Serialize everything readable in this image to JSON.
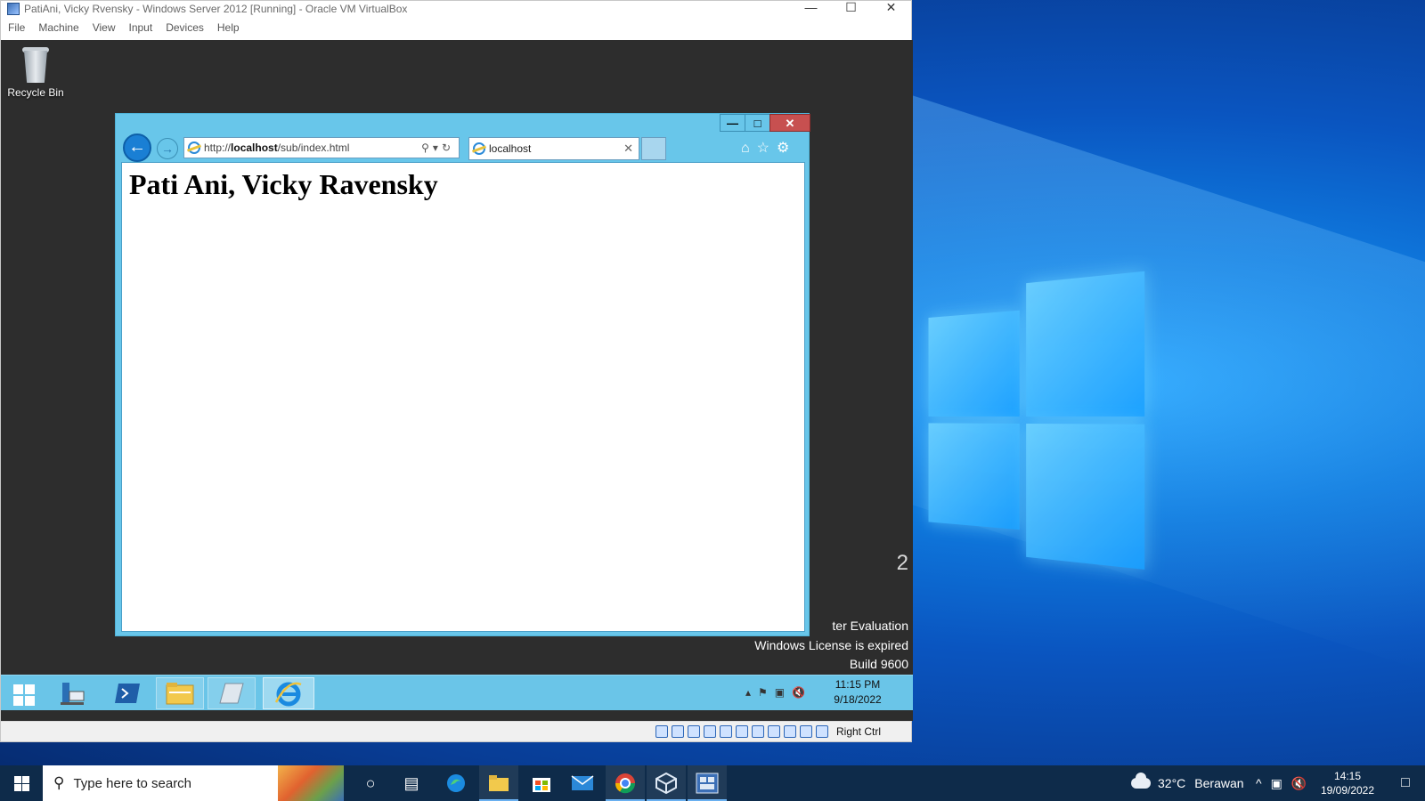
{
  "vbox": {
    "title": "PatiAni, Vicky Rvensky - Windows Server 2012 [Running] - Oracle VM VirtualBox",
    "menu": [
      "File",
      "Machine",
      "View",
      "Input",
      "Devices",
      "Help"
    ],
    "host_key": "Right Ctrl"
  },
  "guest": {
    "recycle_bin_label": "Recycle Bin",
    "watermark": {
      "digit": "2",
      "line1": "ter Evaluation",
      "line2": "Windows License is expired",
      "line3": "Build 9600"
    },
    "taskbar": {
      "time": "11:15 PM",
      "date": "9/18/2022"
    }
  },
  "ie": {
    "url_prefix": "http://",
    "url_host": "localhost",
    "url_path": "/sub/index.html",
    "tab_title": "localhost",
    "heading": "Pati Ani, Vicky Ravensky"
  },
  "host_taskbar": {
    "search_placeholder": "Type here to search",
    "weather_temp": "32°C",
    "weather_desc": "Berawan",
    "time": "14:15",
    "date": "19/09/2022"
  },
  "colors": {
    "ie_chrome": "#68c6ea",
    "ie_close": "#c75050",
    "guest_bg": "#2d2d2d",
    "host_taskbar": "#0e2b4a"
  }
}
